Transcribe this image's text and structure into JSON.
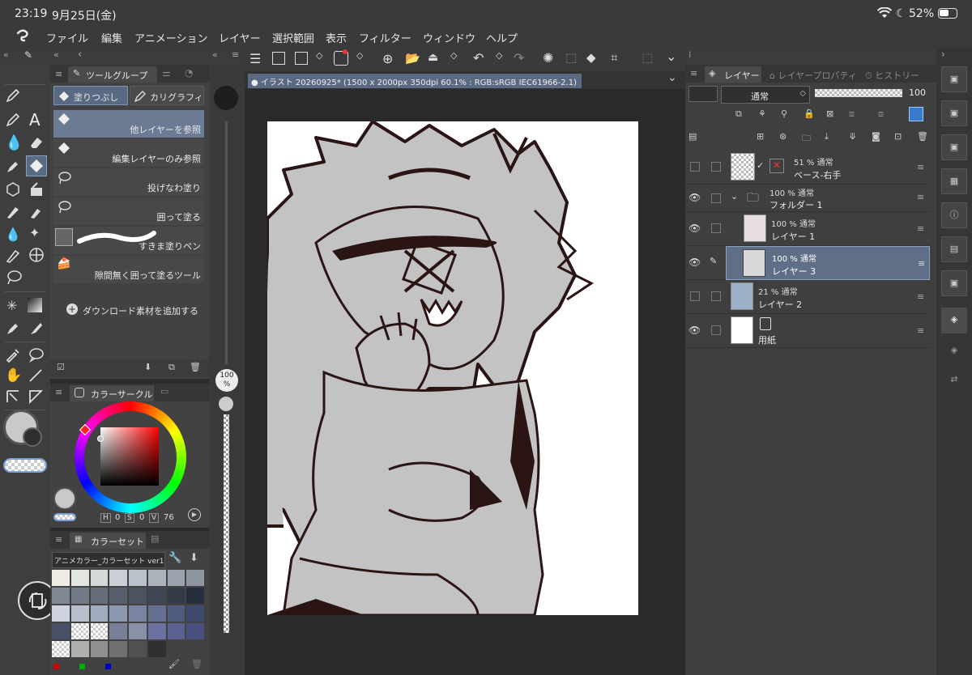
{
  "status_bar": {
    "time": "23:19",
    "date": "9月25日(金)",
    "battery": "52%"
  },
  "menu": {
    "items": [
      "ファイル",
      "編集",
      "アニメーション",
      "レイヤー",
      "選択範囲",
      "表示",
      "フィルター",
      "ウィンドウ",
      "ヘルプ"
    ]
  },
  "tool_group": {
    "tab_label": "ツールグループ",
    "subtool_tabs": [
      "塗りつぶし",
      "カリグラフィ"
    ],
    "subtools": [
      "他レイヤーを参照",
      "編集レイヤーのみ参照",
      "投げなわ塗り",
      "囲って塗る",
      "すきま塗りペン",
      "隙間無く囲って塗るツール"
    ],
    "add_material": "ダウンロード素材を追加する"
  },
  "brush_size": {
    "value": "100",
    "unit": "%"
  },
  "color_circle": {
    "title": "カラーサークル",
    "h_label": "H",
    "h": "0",
    "s_label": "S",
    "s": "0",
    "v_label": "V",
    "v": "76"
  },
  "color_set": {
    "title": "カラーセット",
    "selected": "アニメカラー_カラーセット ver1",
    "swatches": [
      "#f0ece4",
      "#e3e6e0",
      "#d4d9d9",
      "#c9cfd4",
      "#b9c2c9",
      "#aab3bb",
      "#9ba4ad",
      "#8d96a0",
      "#7f8893",
      "#717a86",
      "#646d79",
      "#57606c",
      "#4b5360",
      "#3f4754",
      "#333b48",
      "#262e3b",
      "#cfd4e0",
      "#b8c0d0",
      "#a2acc0",
      "#8c98b0",
      "#7884a0",
      "#647090",
      "#505c80",
      "#3e4a6e",
      "#4a5068",
      "#5a6078",
      "#6a7088",
      "#7a8098",
      "#8a90a8",
      "#6a70a0",
      "#5a6090",
      "#4a5080",
      "#d0d0cc",
      "#b0b0ac",
      "#909090",
      "#707070",
      "#505050",
      "#303030"
    ]
  },
  "document": {
    "title": "イラスト 20260925* (1500 x 2000px 350dpi 60.1% : RGB:sRGB IEC61966-2.1)"
  },
  "layer_panel": {
    "tabs": [
      "レイヤー",
      "レイヤープロパティ",
      "ヒストリー"
    ],
    "blend_mode": "通常",
    "opacity": "100",
    "layers": [
      {
        "opacity": "51 % 通常",
        "name": "ベース-右手"
      },
      {
        "opacity": "100 % 通常",
        "name": "フォルダー 1"
      },
      {
        "opacity": "100 % 通常",
        "name": "レイヤー 1"
      },
      {
        "opacity": "100 % 通常",
        "name": "レイヤー 3"
      },
      {
        "opacity": "21 % 通常",
        "name": "レイヤー 2"
      },
      {
        "name": "用紙"
      }
    ]
  }
}
